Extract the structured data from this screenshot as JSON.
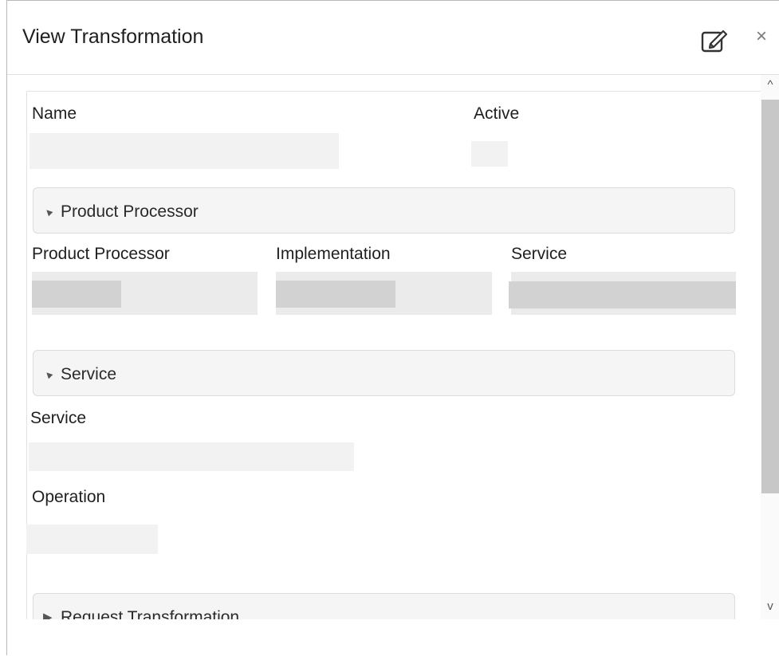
{
  "dialog": {
    "title": "View Transformation",
    "close_glyph": "×",
    "edit_icon": "edit-icon"
  },
  "form": {
    "name_label": "Name",
    "active_label": "Active"
  },
  "product_processor_section": {
    "header": "Product Processor",
    "expanded": true,
    "col1_label": "Product Processor",
    "col2_label": "Implementation",
    "col3_label": "Service"
  },
  "service_section": {
    "header": "Service",
    "expanded": true,
    "service_label": "Service",
    "operation_label": "Operation"
  },
  "request_section": {
    "header": "Request Transformation",
    "expanded": false
  },
  "icons": {
    "expanded": "▲",
    "collapsed": "▶",
    "scroll_up": "^",
    "scroll_down": "v"
  }
}
